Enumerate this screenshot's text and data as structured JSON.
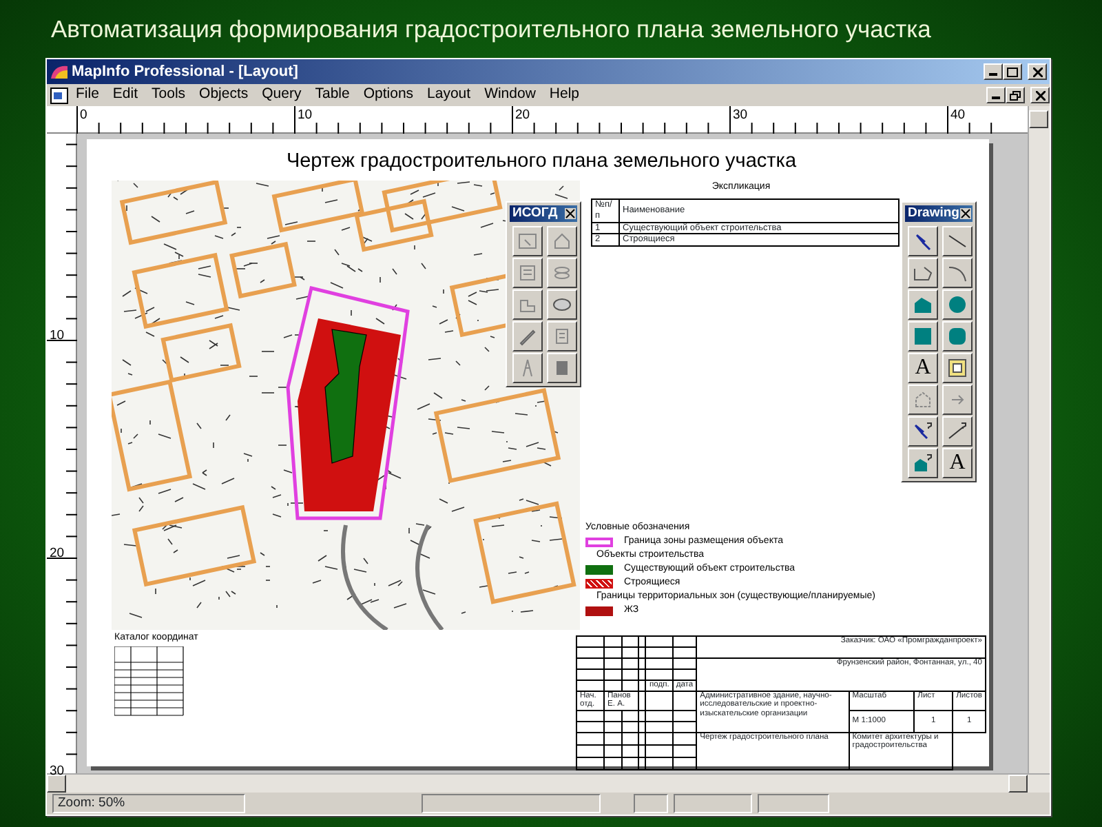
{
  "slide_title": "Автоматизация формирования градостроительного плана земельного участка",
  "window": {
    "title": "MapInfo Professional - [Layout]"
  },
  "menu": [
    "File",
    "Edit",
    "Tools",
    "Objects",
    "Query",
    "Table",
    "Options",
    "Layout",
    "Window",
    "Help"
  ],
  "top_ruler": [
    "0",
    "10",
    "20",
    "30",
    "40"
  ],
  "left_ruler": [
    "10",
    "20",
    "30"
  ],
  "layout_page": {
    "title": "Чертеж градостроительного плана земельного участка",
    "explication": {
      "caption": "Экспликация",
      "columns": [
        "№п/п",
        "Наименование"
      ],
      "rows": [
        [
          "1",
          "Существующий объект строительства"
        ],
        [
          "2",
          "Строящиеся"
        ]
      ]
    },
    "legend": {
      "heading": "Условные обозначения",
      "items": [
        {
          "kind": "outline",
          "color": "#e040e0",
          "label": "Граница зоны размещения объекта"
        },
        {
          "kind": "heading",
          "label": "Объекты строительства"
        },
        {
          "kind": "fill",
          "color": "#107010",
          "label": "Существующий объект строительства"
        },
        {
          "kind": "hatch",
          "color": "#d01010",
          "label": "Строящиеся"
        },
        {
          "kind": "heading",
          "label": "Границы территориальных зон (существующие/планируемые)"
        },
        {
          "kind": "fill",
          "color": "#b01010",
          "label": "ЖЗ"
        }
      ]
    },
    "coordinates": {
      "caption": "Каталог координат"
    },
    "title_block": {
      "customer": "Заказчик: ОАО «Промгражданпроект»",
      "address": "Фрунзенский район, Фонтанная, ул., 40",
      "sign": "подп.",
      "date": "дата",
      "position": "Нач. отд.",
      "person": "Панов Е. А.",
      "object": "Административное здание, научно-исследовательские и проектно-изыскательские организации",
      "scale_head": "Масштаб",
      "sheet_head": "Лист",
      "sheets_head": "Листов",
      "scale": "М 1:1000",
      "sheet": "1",
      "sheets": "1",
      "drawing": "Чертеж градостроительного плана",
      "organization": "Комитет архитектуры и градостроительства"
    }
  },
  "isogd_toolbar": {
    "title": "ИСОГД"
  },
  "drawing_toolbar": {
    "title": "Drawing",
    "buttons": [
      {
        "kind": "symbol"
      },
      {
        "kind": "line"
      },
      {
        "kind": "polyline"
      },
      {
        "kind": "arc"
      },
      {
        "kind": "polygon"
      },
      {
        "kind": "ellipse"
      },
      {
        "kind": "rectangle"
      },
      {
        "kind": "rounded"
      },
      {
        "kind": "text",
        "glyph": "A"
      },
      {
        "kind": "frame"
      },
      {
        "kind": "reshape"
      },
      {
        "kind": "node"
      },
      {
        "kind": "symbol-style"
      },
      {
        "kind": "line-style"
      },
      {
        "kind": "region-style"
      },
      {
        "kind": "text-style",
        "glyph": "A"
      }
    ]
  },
  "status_bar": {
    "zoom": "Zoom: 50%"
  }
}
